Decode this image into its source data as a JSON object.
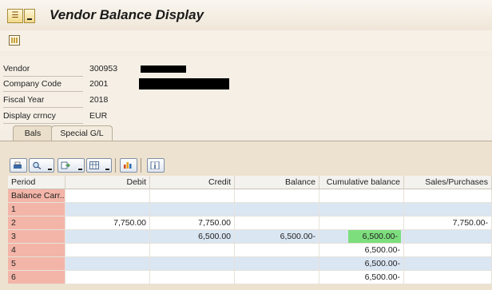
{
  "window": {
    "title": "Vendor Balance Display"
  },
  "header_fields": [
    {
      "label": "Vendor",
      "value": "300953"
    },
    {
      "label": "Company Code",
      "value": "2001"
    },
    {
      "label": "Fiscal Year",
      "value": "2018"
    },
    {
      "label": "Display crrncy",
      "value": "EUR"
    }
  ],
  "tabs": [
    {
      "label": "Bals",
      "active": true
    },
    {
      "label": "Special G/L",
      "active": false
    }
  ],
  "alv_toolbar": {
    "icons": [
      "print-icon",
      "find-icon",
      "export-icon",
      "layout-icon",
      "chart-icon",
      "info-icon"
    ]
  },
  "table": {
    "columns": [
      "Period",
      "Debit",
      "Credit",
      "Balance",
      "Cumulative balance",
      "Sales/Purchases"
    ],
    "rows": [
      {
        "period": "Balance Carr...",
        "debit": "",
        "credit": "",
        "balance": "",
        "cumulative": "",
        "sales": ""
      },
      {
        "period": "1",
        "debit": "",
        "credit": "",
        "balance": "",
        "cumulative": "",
        "sales": ""
      },
      {
        "period": "2",
        "debit": "7,750.00",
        "credit": "7,750.00",
        "balance": "",
        "cumulative": "",
        "sales": "7,750.00-"
      },
      {
        "period": "3",
        "debit": "",
        "credit": "6,500.00",
        "balance": "6,500.00-",
        "cumulative": "6,500.00-",
        "sales": ""
      },
      {
        "period": "4",
        "debit": "",
        "credit": "",
        "balance": "",
        "cumulative": "6,500.00-",
        "sales": ""
      },
      {
        "period": "5",
        "debit": "",
        "credit": "",
        "balance": "",
        "cumulative": "6,500.00-",
        "sales": ""
      },
      {
        "period": "6",
        "debit": "",
        "credit": "",
        "balance": "",
        "cumulative": "6,500.00-",
        "sales": ""
      }
    ]
  },
  "colors": {
    "key_column": "#f3b5a8",
    "highlight": "#7dde7d",
    "row_alt": "#dbe6f3"
  }
}
